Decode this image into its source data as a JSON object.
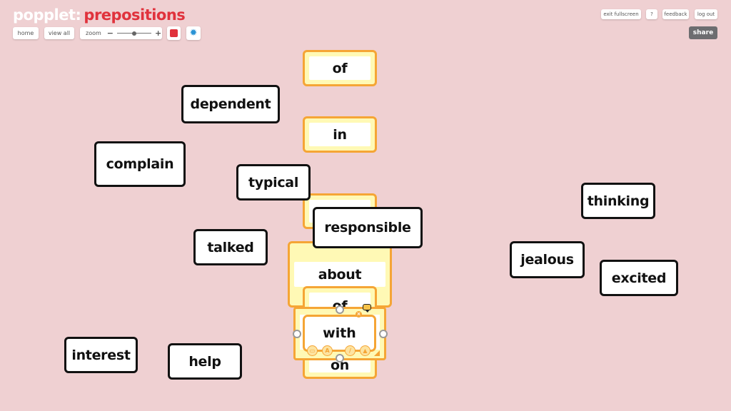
{
  "header": {
    "brand": "popplet:",
    "board_title": "prepositions"
  },
  "toolbar": {
    "home_label": "home",
    "view_all_label": "view all",
    "zoom_label": "zoom",
    "zoom_minus": "−",
    "zoom_plus": "+",
    "zoom_level_fraction": 0.5,
    "color_swatch": "#e0323c",
    "settings_icon": "gear-icon"
  },
  "top_right": {
    "exit_fullscreen_label": "exit fullscreen",
    "help_label": "?",
    "feedback_label": "feedback",
    "logout_label": "log out",
    "share_label": "share"
  },
  "colors": {
    "background": "#efd0d2",
    "brand_red": "#e0323c",
    "popple_yellow_border": "#f5a535",
    "popple_yellow_fill": "#fff9b5",
    "popple_black_border": "#111111"
  },
  "popples": {
    "black": [
      {
        "text": "dependent"
      },
      {
        "text": "complain"
      },
      {
        "text": "typical"
      },
      {
        "text": "talked"
      },
      {
        "text": "responsible"
      },
      {
        "text": "interest"
      },
      {
        "text": "help"
      },
      {
        "text": "thinking"
      },
      {
        "text": "jealous"
      },
      {
        "text": "excited"
      }
    ],
    "yellow": [
      {
        "text": "of"
      },
      {
        "text": "in"
      },
      {
        "text": ""
      },
      {
        "text": "about"
      },
      {
        "text": "of"
      },
      {
        "text": "on"
      }
    ],
    "selected": {
      "text": "with"
    }
  },
  "selected_tools": [
    "frame-icon",
    "text-icon",
    "pencil-icon",
    "image-icon"
  ],
  "selected_tool_glyphs": [
    "▭",
    "A",
    "/",
    "▲"
  ]
}
